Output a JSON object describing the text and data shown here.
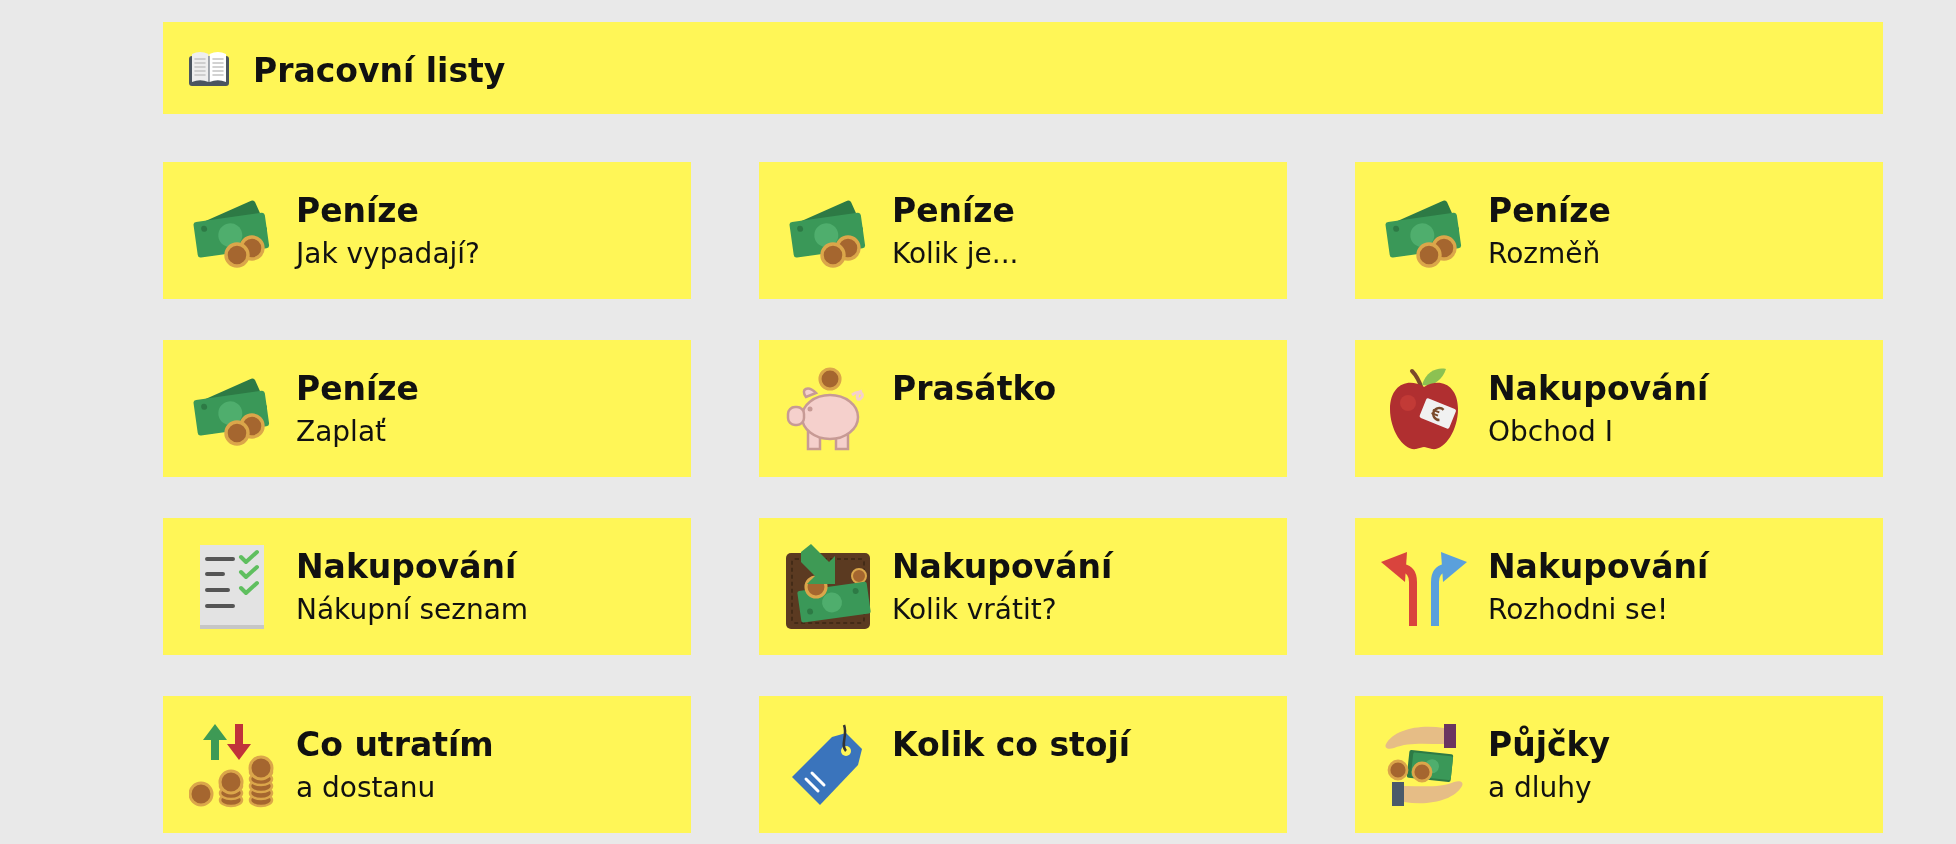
{
  "header": {
    "title": "Pracovní listy"
  },
  "cards": [
    {
      "kind": "money",
      "title": "Peníze",
      "subtitle": "Jak vypadají?"
    },
    {
      "kind": "money",
      "title": "Peníze",
      "subtitle": "Kolik je..."
    },
    {
      "kind": "money",
      "title": "Peníze",
      "subtitle": "Rozměň"
    },
    {
      "kind": "money",
      "title": "Peníze",
      "subtitle": "Zaplať"
    },
    {
      "kind": "piggy",
      "title": "Prasátko"
    },
    {
      "kind": "apple",
      "title": "Nakupování",
      "subtitle": "Obchod I"
    },
    {
      "kind": "checklist",
      "title": "Nakupování",
      "subtitle": "Nákupní seznam"
    },
    {
      "kind": "wallet",
      "title": "Nakupování",
      "subtitle": "Kolik vrátit?"
    },
    {
      "kind": "arrows",
      "title": "Nakupování",
      "subtitle": "Rozhodni se!"
    },
    {
      "kind": "coins",
      "title": "Co utratím",
      "subtitle": "a dostanu"
    },
    {
      "kind": "tag",
      "title": "Kolik co stojí"
    },
    {
      "kind": "hands",
      "title": "Půjčky",
      "subtitle": "a dluhy"
    }
  ]
}
